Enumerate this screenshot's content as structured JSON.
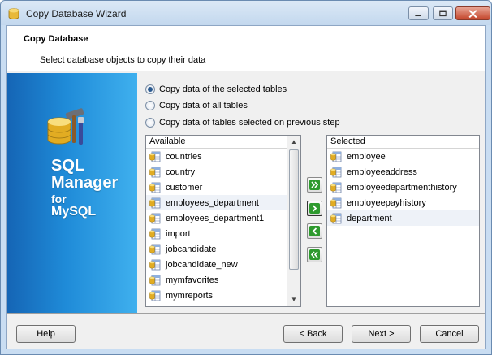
{
  "window": {
    "title": "Copy Database Wizard"
  },
  "header": {
    "title": "Copy Database",
    "subtitle": "Select database objects to copy their data"
  },
  "banner": {
    "line1": "SQL",
    "line2": "Manager",
    "line3": "for",
    "line4": "MySQL"
  },
  "options": {
    "selected_tables": "Copy data of the selected tables",
    "all_tables": "Copy data of all tables",
    "previous_step": "Copy data of tables selected on  previous step",
    "checked": "selected_tables"
  },
  "available": {
    "header": "Available",
    "items": [
      "countries",
      "country",
      "customer",
      "employees_department",
      "employees_department1",
      "import",
      "jobcandidate",
      "jobcandidate_new",
      "mymfavorites",
      "mymreports"
    ]
  },
  "selected": {
    "header": "Selected",
    "items": [
      "employee",
      "employeeaddress",
      "employeedepartmenthistory",
      "employeepayhistory",
      "department"
    ]
  },
  "buttons": {
    "help": "Help",
    "back": "< Back",
    "next": "Next >",
    "cancel": "Cancel"
  },
  "colors": {
    "arrow_green": "#2e9a2e",
    "banner_blue": "#1f8bd8"
  }
}
